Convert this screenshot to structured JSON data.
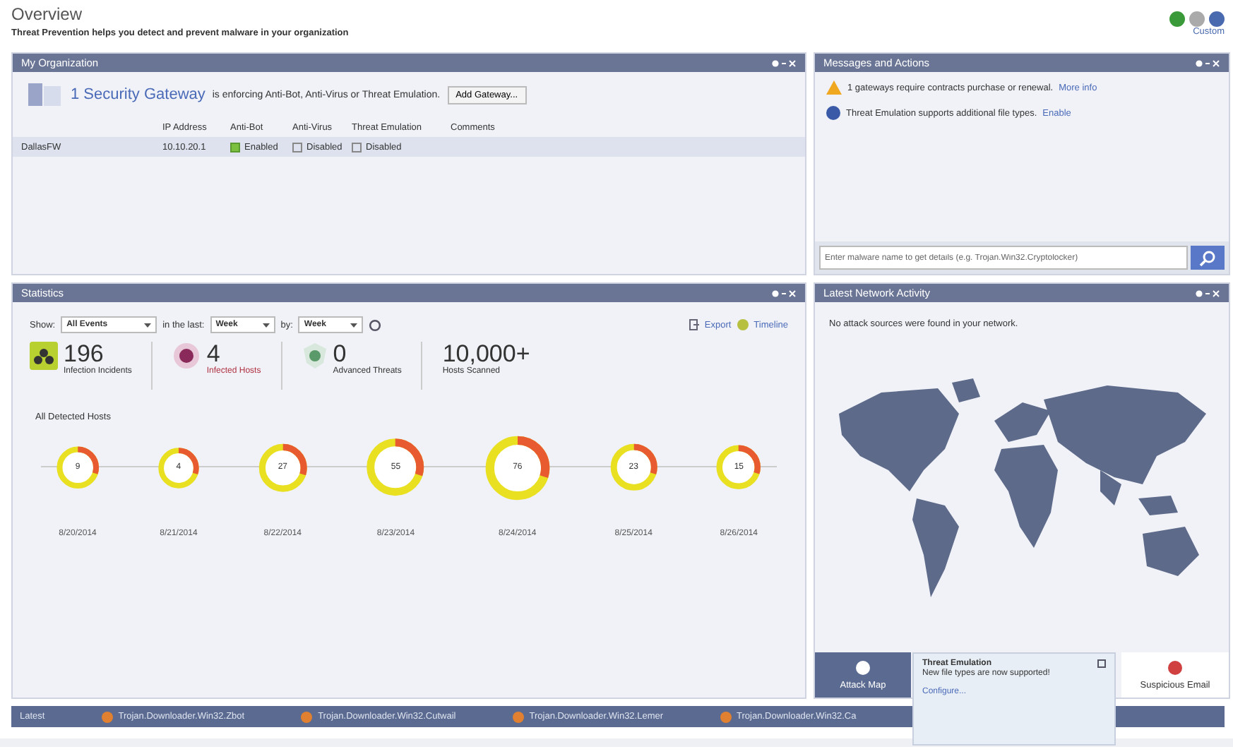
{
  "header": {
    "title": "Overview",
    "subtitle": "Threat Prevention helps you detect and prevent malware in your organization",
    "user_label": "Custom"
  },
  "organization": {
    "title": "My Organization",
    "gateway_link": "1 Security Gateway",
    "gateway_text": "is enforcing Anti-Bot, Anti-Virus or Threat Emulation.",
    "add_button": "Add Gateway...",
    "columns": [
      "",
      "IP Address",
      "Anti-Bot",
      "Anti-Virus",
      "Threat Emulation",
      "Comments"
    ],
    "rows": [
      {
        "name": "DallasFW",
        "ip": "10.10.20.1",
        "blades": [
          {
            "label": "Enabled",
            "on": true
          },
          {
            "label": "Disabled",
            "on": false
          },
          {
            "label": "Disabled",
            "on": false
          }
        ]
      }
    ]
  },
  "messages": {
    "title": "Messages and Actions",
    "items": [
      {
        "kind": "warning",
        "text": "1 gateways require contracts purchase or renewal.",
        "link": "More info"
      },
      {
        "kind": "info",
        "text": "Threat Emulation supports additional file types.",
        "link": "Enable"
      }
    ],
    "search": {
      "placeholder": "Enter malware name to get details (e.g. Trojan.Win32.Cryptolocker)"
    }
  },
  "statistics": {
    "title": "Statistics",
    "show_label": "Show:",
    "show_value": "All Events",
    "last_label": "in the last:",
    "last_value": "Week",
    "by_label": "by:",
    "by_value": "Week",
    "export": "Export",
    "timeline": "Timeline",
    "stats": [
      {
        "kind": "infection",
        "value": "196",
        "label": "Infection Incidents"
      },
      {
        "kind": "bot",
        "value": "4",
        "label": "Infected Hosts"
      },
      {
        "kind": "advanced",
        "value": "0",
        "label": "Advanced Threats"
      },
      {
        "kind": "plain",
        "value": "10,000+",
        "label": "Hosts Scanned"
      }
    ],
    "hosts_title": "All Detected Hosts",
    "hosts": [
      {
        "count": "9",
        "date": "8/20/2014"
      },
      {
        "count": "4",
        "date": "8/21/2014"
      },
      {
        "count": "27",
        "date": "8/22/2014"
      },
      {
        "count": "55",
        "date": "8/23/2014"
      },
      {
        "count": "76",
        "date": "8/24/2014"
      },
      {
        "count": "23",
        "date": "8/25/2014"
      },
      {
        "count": "15",
        "date": "8/26/2014"
      }
    ]
  },
  "activity": {
    "title": "Latest Network Activity",
    "note": "No attack sources were found in your network.",
    "tabs": [
      {
        "label": "Attack Map",
        "selected": true
      },
      {
        "label": "Suspicious Email",
        "selected": false
      }
    ]
  },
  "ticker": {
    "label": "Latest",
    "items": [
      "Trojan.Downloader.Win32.Zbot",
      "Trojan.Downloader.Win32.Cutwail",
      "Trojan.Downloader.Win32.Lemer",
      "Trojan.Downloader.Win32.Ca"
    ]
  },
  "toast": {
    "title": "Threat Emulation",
    "text": "New file types are now supported!",
    "link": "Configure..."
  }
}
